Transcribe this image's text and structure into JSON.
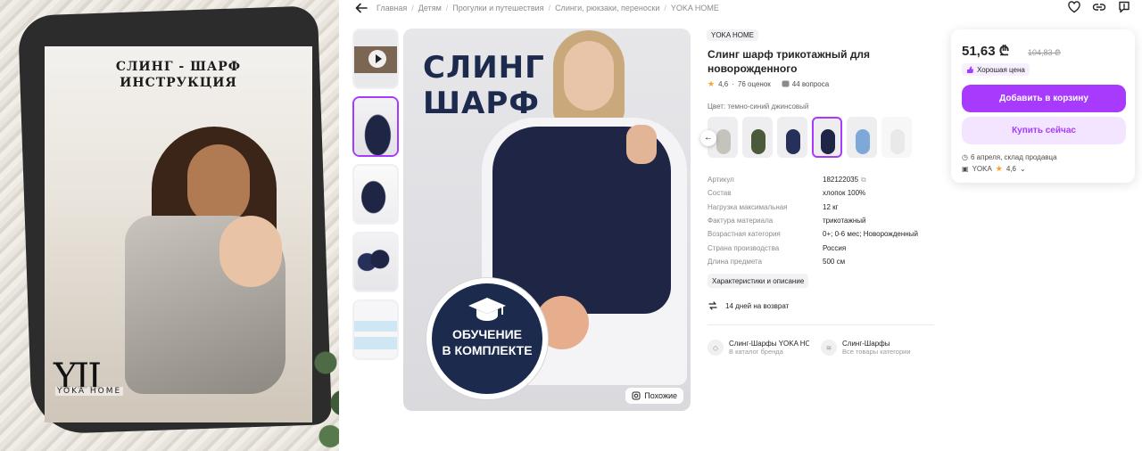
{
  "left_photo": {
    "title_line1": "СЛИНГ - ШАРФ",
    "title_line2": "ИНСТРУКЦИЯ",
    "logo_mark": "YII",
    "logo_text": "YOKA HOME"
  },
  "breadcrumbs": [
    "Главная",
    "Детям",
    "Прогулки и путешествия",
    "Слинги, рюкзаки, переноски",
    "YOKA HOME"
  ],
  "top_icons": [
    "heart-icon",
    "link-icon",
    "report-icon"
  ],
  "thumbnails": [
    {
      "type": "video",
      "active": false
    },
    {
      "type": "image",
      "active": true
    },
    {
      "type": "image",
      "active": false
    },
    {
      "type": "image",
      "active": false
    },
    {
      "type": "image",
      "active": false
    }
  ],
  "main_image": {
    "headline_line1": "СЛИНГ",
    "headline_line2": "ШАРФ",
    "badge_line1": "ОБУЧЕНИЕ",
    "badge_line2": "В КОМПЛЕКТЕ",
    "similar_label": "Похожие"
  },
  "product": {
    "brand": "YOKA HOME",
    "title": "Слинг шарф трикотажный для новорожденного",
    "rating": "4,6",
    "reviews": "76 оценок",
    "questions": "44 вопроса",
    "color_label": "Цвет: темно-синий джинсовый",
    "swatch_colors": [
      "#c6c2bc",
      "#4a5a3a",
      "#26305a",
      "#1f2544",
      "#7ea8d8",
      "#cfcfd2"
    ],
    "active_swatch": 3,
    "specs": [
      {
        "k": "Артикул",
        "v": "182122035"
      },
      {
        "k": "Состав",
        "v": "хлопок 100%"
      },
      {
        "k": "Нагрузка максимальная",
        "v": "12 кг"
      },
      {
        "k": "Фактура материала",
        "v": "трикотажный"
      },
      {
        "k": "Возрастная категория",
        "v": "0+; 0-6 мес; Новорожденный"
      },
      {
        "k": "Страна производства",
        "v": "Россия"
      },
      {
        "k": "Длина предмета",
        "v": "500 см"
      }
    ],
    "characteristics_button": "Характеристики и описание",
    "return_text": "14 дней на возврат",
    "category_links": [
      {
        "title": "Слинг-Шарфы YOKA HO",
        "sub": "В каталог бренда"
      },
      {
        "title": "Слинг-Шарфы",
        "sub": "Все товары категории"
      }
    ]
  },
  "price_card": {
    "price": "51,63 ₾",
    "old_price": "104,83 ₾",
    "good_price_label": "Хорошая цена",
    "add_to_cart": "Добавить в корзину",
    "buy_now": "Купить сейчас",
    "delivery": "6 апреля, склад продавца",
    "seller_name": "YOKA",
    "seller_rating": "4,6"
  },
  "colors": {
    "accent": "#a73afd",
    "accent_light": "#f3e5ff",
    "navy": "#1b2a4d",
    "star": "#ff9f1c"
  }
}
